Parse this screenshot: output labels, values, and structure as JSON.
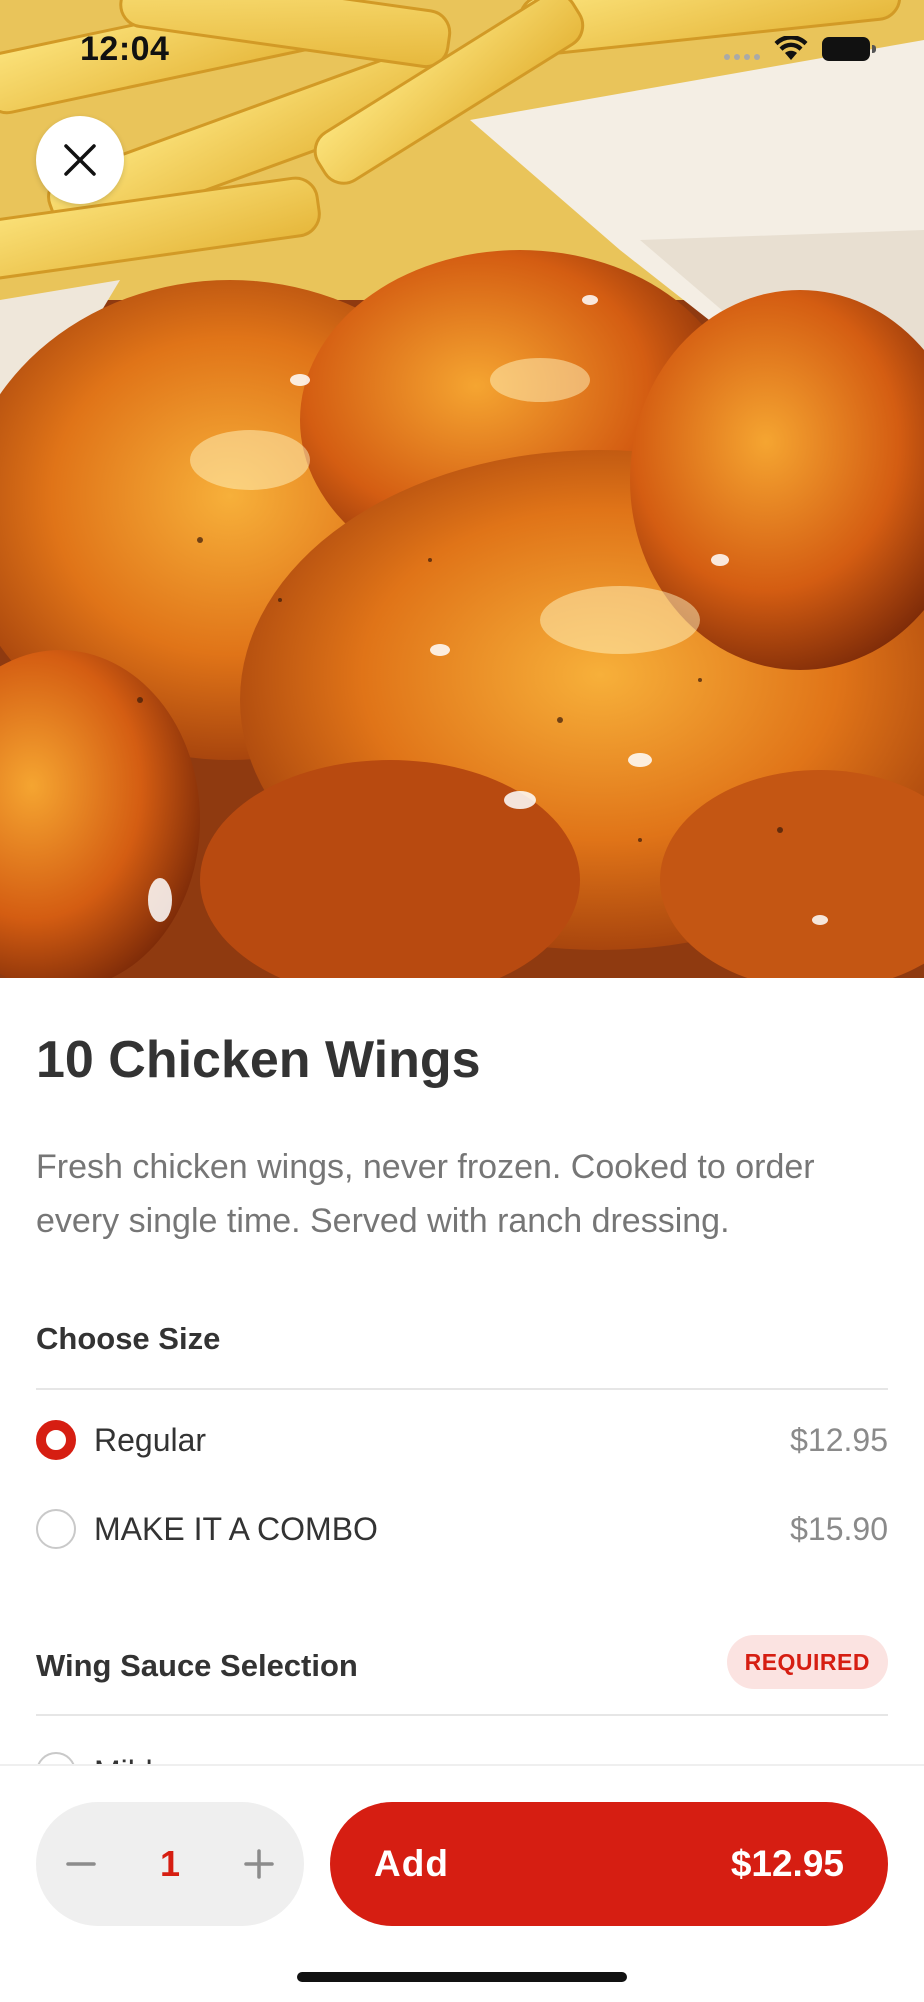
{
  "status_bar": {
    "time": "12:04",
    "icons": [
      "cellular-icon",
      "wifi-icon",
      "battery-icon"
    ]
  },
  "hero": {
    "icon": "food-photo"
  },
  "close_button": {
    "icon": "close-icon"
  },
  "item": {
    "title": "10 Chicken Wings",
    "description": "Fresh chicken wings, never frozen. Cooked to order every single time. Served with ranch dressing."
  },
  "sections": [
    {
      "title": "Choose Size",
      "options": [
        {
          "label": "Regular",
          "price": "$12.95",
          "selected": true
        },
        {
          "label": "MAKE IT A COMBO",
          "price": "$15.90",
          "selected": false
        }
      ]
    },
    {
      "title": "Wing Sauce Selection",
      "badge": "REQUIRED",
      "options": [
        {
          "label": "Mild",
          "selected": false
        }
      ]
    }
  ],
  "bottom_bar": {
    "quantity": "1",
    "minus_icon": "minus-icon",
    "plus_icon": "plus-icon",
    "add_label": "Add",
    "add_price": "$12.95"
  },
  "colors": {
    "accent": "#d61e12",
    "badge_bg": "#fbe3e1",
    "stepper_bg": "#efefef",
    "text_primary": "#333333",
    "text_secondary": "#767676"
  }
}
